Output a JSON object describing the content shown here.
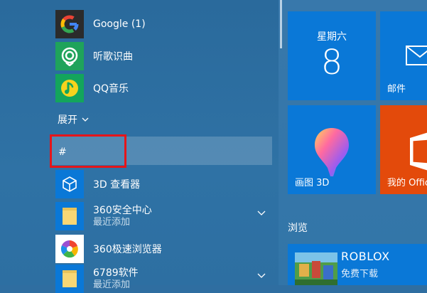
{
  "app_list": {
    "apps_top": [
      {
        "label": "Google (1)",
        "icon": "google-icon"
      },
      {
        "label": "听歌识曲",
        "icon": "music-recognition-icon"
      },
      {
        "label": "QQ音乐",
        "icon": "qq-music-icon"
      }
    ],
    "expand_label": "展开",
    "group_hash_label": "#",
    "apps_hash": [
      {
        "label": "3D 查看器",
        "icon": "3d-viewer-icon"
      },
      {
        "label": "360安全中心",
        "subtitle": "最近添加",
        "icon": "folder-icon"
      },
      {
        "label": "360极速浏览器",
        "icon": "360-browser-icon"
      },
      {
        "label": "6789软件",
        "subtitle": "最近添加",
        "icon": "folder-icon"
      }
    ]
  },
  "tiles": {
    "calendar": {
      "day": "星期六",
      "date": "8"
    },
    "mail": {
      "label": "邮件"
    },
    "paint3d": {
      "label": "画图 3D"
    },
    "office": {
      "label": "我的 Office"
    },
    "section_browse": "浏览",
    "store": {
      "title": "ROBLOX",
      "subtitle": "免费下载"
    }
  },
  "colors": {
    "tile_blue": "#0a78d7",
    "office_orange": "#e34a0b",
    "highlight_red": "#e5151a"
  }
}
